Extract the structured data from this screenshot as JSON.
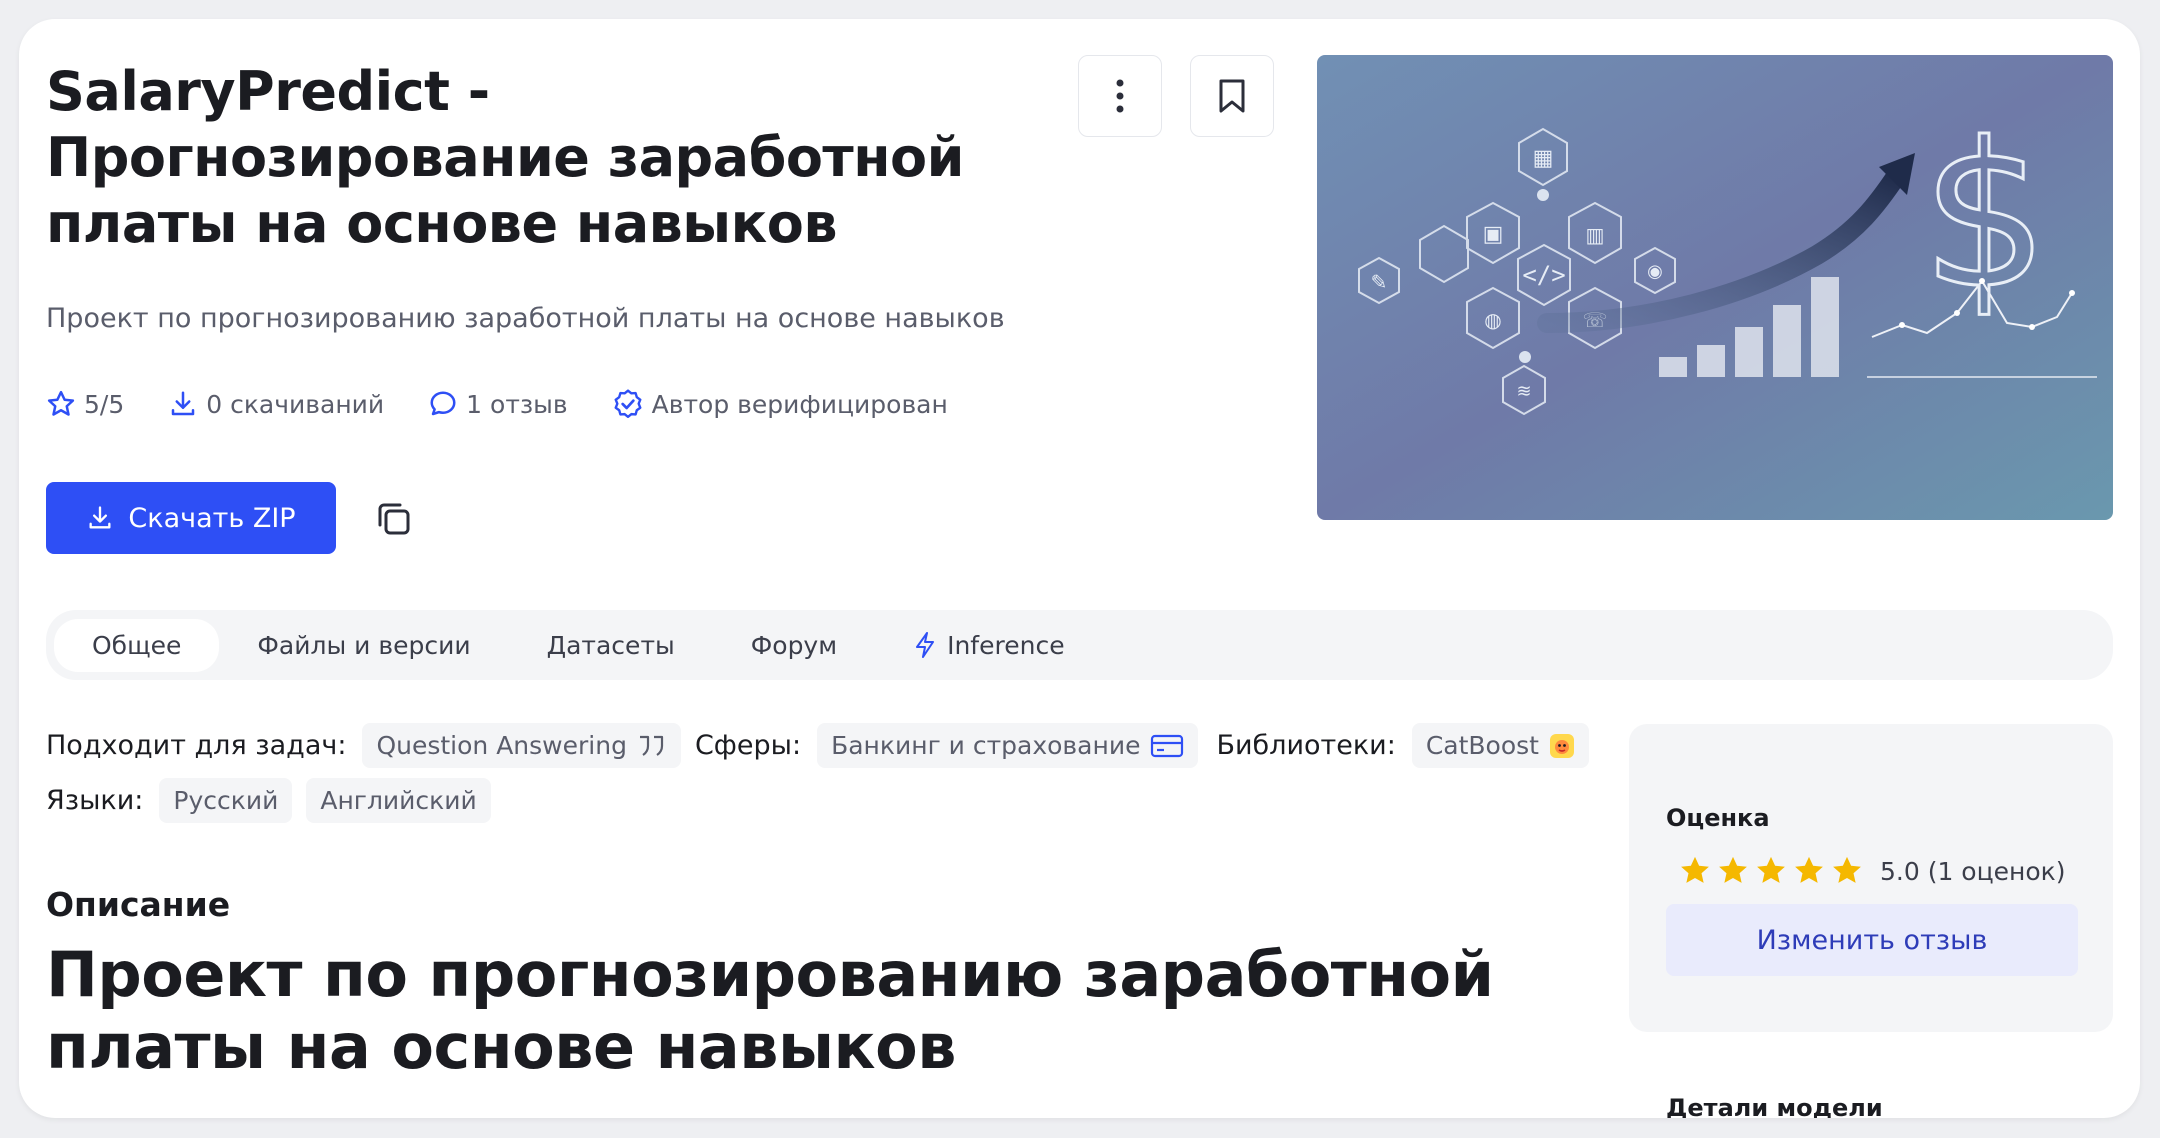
{
  "header": {
    "title": "SalaryPredict - Прогнозирование заработной платы на основе навыков",
    "subtitle": "Проект по прогнозированию заработной платы на основе навыков"
  },
  "stats": {
    "rating": "5/5",
    "downloads": "0 скачиваний",
    "reviews": "1 отзыв",
    "verified": "Автор верифицирован"
  },
  "actions": {
    "download_label": "Скачать ZIP"
  },
  "tabs": [
    {
      "label": "Общее",
      "active": true
    },
    {
      "label": "Файлы и версии"
    },
    {
      "label": "Датасеты"
    },
    {
      "label": "Форум"
    },
    {
      "label": "Inference"
    }
  ],
  "tags": {
    "tasks_label": "Подходит для задач:",
    "task": "Question Answering",
    "spheres_label": "Сферы:",
    "sphere": "Банкинг и страхование",
    "libraries_label": "Библиотеки:",
    "library": "CatBoost",
    "languages_label": "Языки:",
    "languages": [
      "Русский",
      "Английский"
    ]
  },
  "description": {
    "section_title": "Описание",
    "heading": "Проект по прогнозированию заработной платы на основе навыков"
  },
  "rating_panel": {
    "title": "Оценка",
    "stars": 5,
    "score_text": "5.0 (1 оценок)",
    "review_button": "Изменить отзыв"
  },
  "details": {
    "title": "Детали модели"
  },
  "colors": {
    "accent": "#2e4ff5",
    "star": "#f5b800",
    "review_button_bg": "#e9ebfc"
  }
}
